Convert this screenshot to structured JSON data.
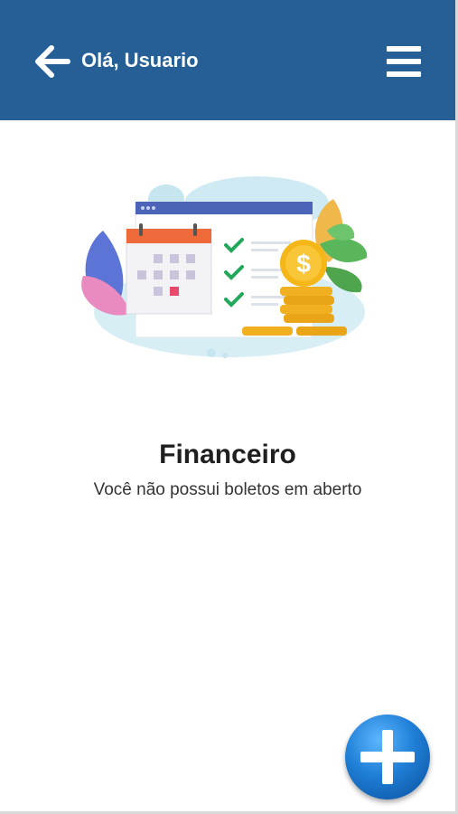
{
  "header": {
    "greeting": "Olá, Usuario",
    "back_icon": "arrow-left-icon",
    "menu_icon": "hamburger-menu-icon",
    "background_color": "#255f96"
  },
  "main": {
    "illustration": "finance-calendar-coins-illustration",
    "title": "Financeiro",
    "subtitle": "Você não possui boletos em aberto"
  },
  "fab": {
    "icon": "plus-icon"
  }
}
